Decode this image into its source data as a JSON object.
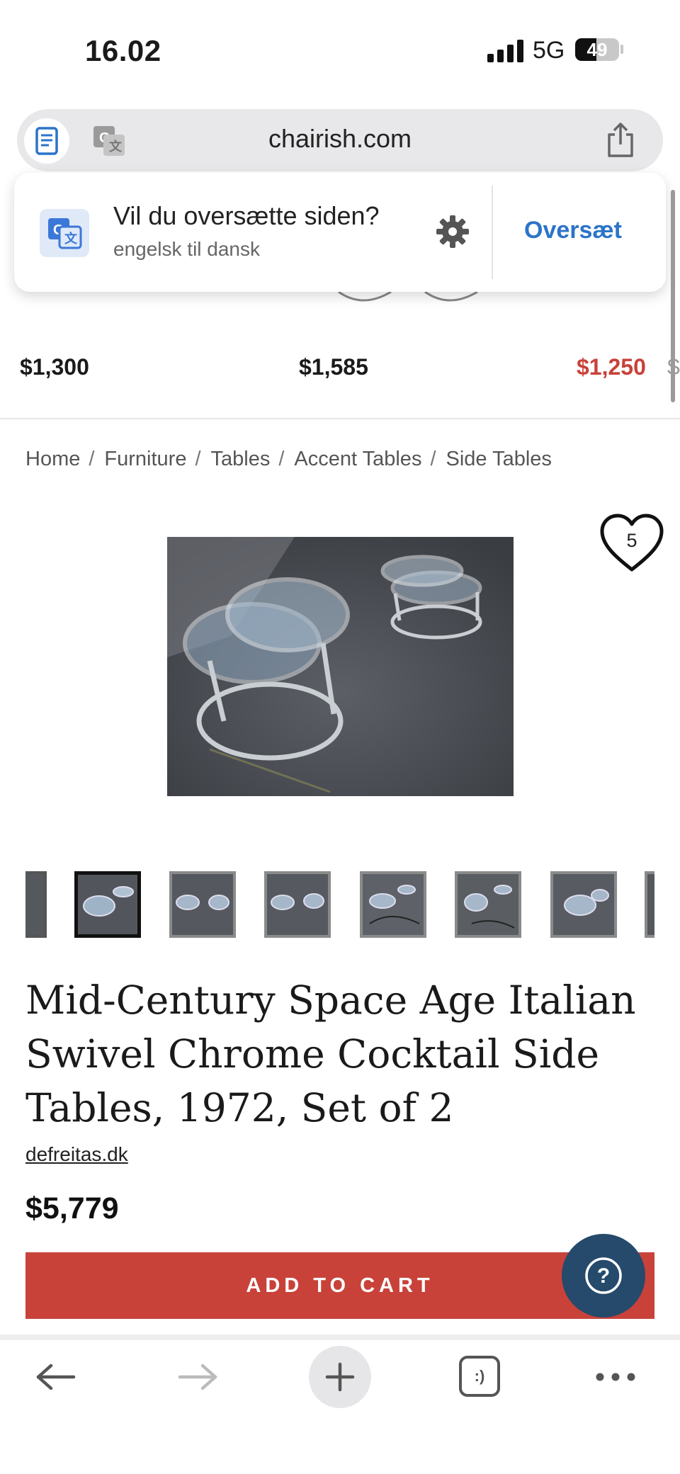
{
  "status_bar": {
    "time": "16.02",
    "network": "5G",
    "battery": "49"
  },
  "browser": {
    "url": "chairish.com"
  },
  "translate_popup": {
    "title": "Vil du oversætte siden?",
    "subtitle": "engelsk til dansk",
    "action": "Oversæt"
  },
  "related_prices": [
    {
      "price": "$1,300",
      "color": "#111111"
    },
    {
      "price": "$1,585",
      "color": "#111111"
    },
    {
      "price": "$1,250",
      "color": "#c8423a"
    }
  ],
  "breadcrumb": [
    "Home",
    "Furniture",
    "Tables",
    "Accent Tables",
    "Side Tables"
  ],
  "favorite_count": "5",
  "product": {
    "title": "Mid-Century Space Age Italian Swivel Chrome Cocktail Side Tables, 1972, Set of 2",
    "seller": "defreitas.dk",
    "price": "$5,779",
    "cta": "ADD TO CART"
  },
  "help_label": "?",
  "tab_count_label": ":)",
  "colors": {
    "accent_red": "#c8423a",
    "help_blue": "#254a6b",
    "link_blue": "#2b74c9"
  }
}
